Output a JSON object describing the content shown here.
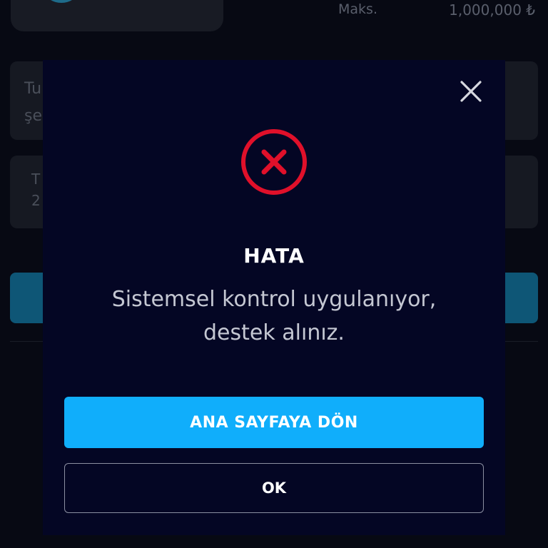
{
  "background": {
    "limit_label": "Maks.",
    "limit_value": "1,000,000 ₺",
    "box1_text_line1": "Tu",
    "box1_text_line2": "şe",
    "box2_text_line1": "T",
    "box2_text_line2": "2"
  },
  "modal": {
    "close_icon": "close-icon",
    "status_icon": "error-x-circle-icon",
    "title": "HATA",
    "message_line1": "Sistemsel kontrol uygulanıyor,",
    "message_line2": "destek alınız.",
    "primary_button_label": "ANA SAYFAYA DÖN",
    "secondary_button_label": "OK"
  },
  "colors": {
    "modal_background": "#040624",
    "error_red": "#e0102a",
    "primary_button": "#10aefb",
    "page_background": "#070913"
  }
}
